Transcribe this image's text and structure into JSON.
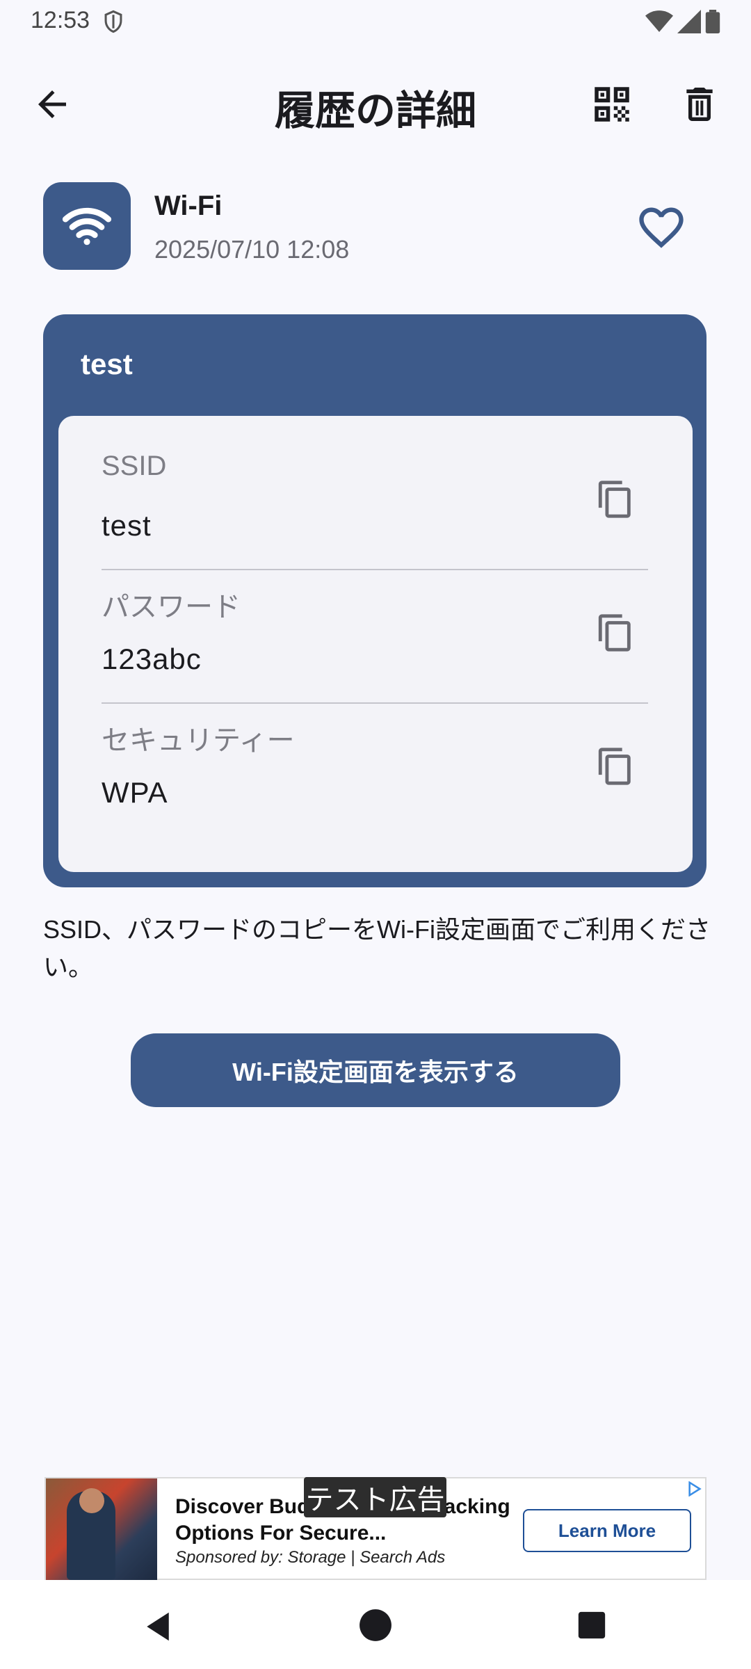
{
  "status_bar": {
    "time": "12:53"
  },
  "app_bar": {
    "title": "履歴の詳細"
  },
  "header": {
    "type_name": "Wi-Fi",
    "date": "2025/07/10 12:08"
  },
  "card": {
    "title": "test",
    "fields": [
      {
        "label": "SSID",
        "value": "test"
      },
      {
        "label": "パスワード",
        "value": "123abc"
      },
      {
        "label": "セキュリティー",
        "value": "WPA"
      }
    ]
  },
  "note": "SSID、パスワードのコピーをWi-Fi設定画面でご利用ください。",
  "primary_button": "Wi-Fi設定画面を表示する",
  "ad": {
    "test_label": "テスト広告",
    "headline": "Discover Budget London Racking Options For Secure...",
    "sponsor": "Sponsored by: Storage | Search Ads",
    "cta": "Learn More"
  },
  "colors": {
    "accent": "#3d5a8a",
    "background": "#f8f8fd",
    "inner_card": "#f3f3f8"
  },
  "icons": [
    "back-arrow-icon",
    "qr-code-icon",
    "trash-icon",
    "wifi-icon",
    "heart-outline-icon",
    "copy-icon"
  ]
}
